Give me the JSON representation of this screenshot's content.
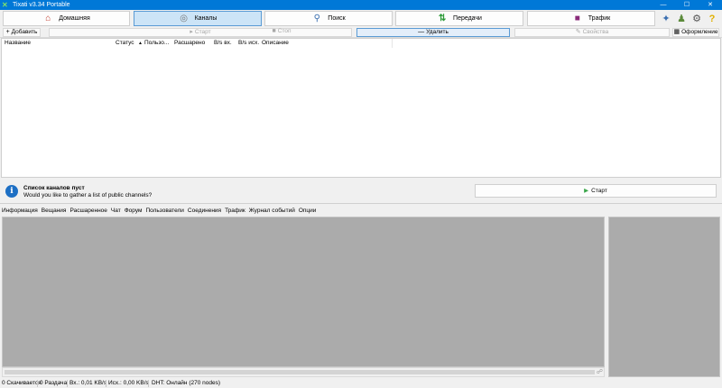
{
  "window": {
    "title": "Tixati v3.34 Portable",
    "app_icon": "tixati-x-icon",
    "controls": [
      "—",
      "☐",
      "✕"
    ]
  },
  "main_toolbar": {
    "buttons": [
      {
        "label": "Домашняя",
        "icon": "home-icon",
        "active": false
      },
      {
        "label": "Каналы",
        "icon": "channels-icon",
        "active": true
      },
      {
        "label": "Поиск",
        "icon": "search-icon",
        "active": false
      },
      {
        "label": "Передачи",
        "icon": "transfers-icon",
        "active": false
      },
      {
        "label": "Трафик",
        "icon": "traffic-icon",
        "active": false
      }
    ],
    "right_icons": [
      "share-icon",
      "users-icon",
      "settings-icon",
      "help-icon"
    ]
  },
  "sub_toolbar": {
    "add": "Добавить",
    "start": "Старт",
    "stop": "Стоп",
    "delete": "Удалить",
    "properties": "Свойства",
    "appearance": "Оформление"
  },
  "channel_list": {
    "columns": [
      "Название",
      "Статус",
      "Пользо...",
      "Расшарено",
      "B/s вх.",
      "B/s исх.",
      "Описание"
    ],
    "sort_indicator": "▲",
    "rows": []
  },
  "info_bar": {
    "title": "Список каналов пуст",
    "message": "Would you like to gather a list of public channels?",
    "start_button": "Старт",
    "icon": "info-icon"
  },
  "detail_tabs": [
    "Информация",
    "Вещания",
    "Расшаренное",
    "Чат",
    "Форум",
    "Пользователи",
    "Соединения",
    "Трафик",
    "Журнал событий",
    "Опции"
  ],
  "status_bar": {
    "downloading": "0 Скачивается",
    "seeding": "0 Раздача",
    "in_speed": "Вх.: 0,01 KB/s",
    "out_speed": "Исх.: 0,00 KB/s",
    "dht": "DHT: Онлайн (270 nodes)"
  },
  "colors": {
    "titlebar": "#0078d7",
    "active_button": "#cce4f7",
    "pane_gray": "#ababab",
    "info_icon": "#1d6fc4",
    "start_green": "#3aa64a"
  }
}
